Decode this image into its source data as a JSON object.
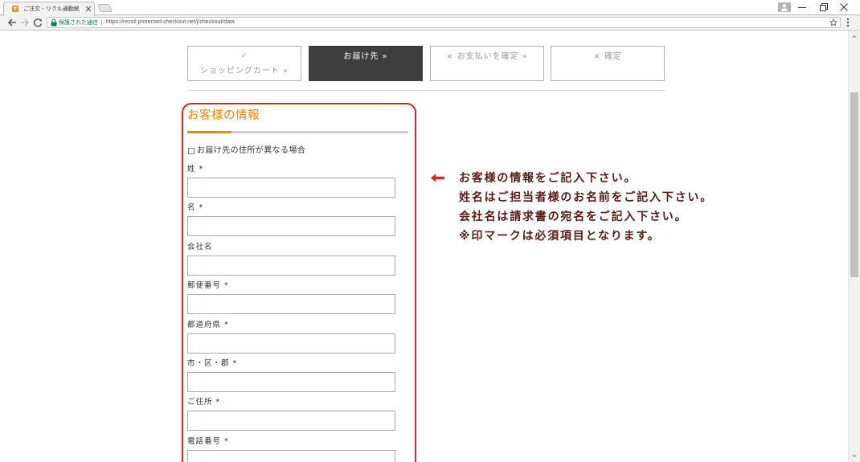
{
  "browser": {
    "tab_title": "ご注文 - リクル通勤統",
    "secure_label": "保護された通信",
    "url": "https://recoil.protected-checkout.net/j/checkout/data"
  },
  "icons": {
    "favicon": "site-favicon-icon",
    "tab_close": "close-icon",
    "profile": "user-profile-icon",
    "minimize": "minimize-icon",
    "restore": "restore-icon",
    "close_window": "close-icon",
    "back": "arrow-left-icon",
    "forward": "arrow-right-icon",
    "reload": "reload-icon",
    "secure": "lock-icon",
    "bookmark": "star-icon",
    "menu": "more-vertical-icon",
    "annotation_arrow": "arrow-left-icon",
    "scroll_up": "triangle-up-icon",
    "scroll_down": "triangle-down-icon"
  },
  "checkout_steps": [
    {
      "mark": "✓",
      "label": "ショッピングカート »",
      "completed": true,
      "active": false
    },
    {
      "label": "お届け先 »",
      "completed": false,
      "active": true
    },
    {
      "label": "× お支払いを確定 »",
      "completed": false,
      "active": false
    },
    {
      "label": "× 確定",
      "completed": false,
      "active": false
    }
  ],
  "form": {
    "title": "お客様の情報",
    "different_address": {
      "label": "お届け先の住所が異なる場合",
      "checked": false
    },
    "fields": [
      {
        "label": "姓",
        "required_mark": "*",
        "value": ""
      },
      {
        "label": "名",
        "required_mark": "*",
        "value": ""
      },
      {
        "label": "会社名",
        "required_mark": "",
        "value": ""
      },
      {
        "label": "郵便番号",
        "required_mark": "*",
        "value": ""
      },
      {
        "label": "都道府県",
        "required_mark": "*",
        "value": ""
      },
      {
        "label": "市・区・郡",
        "required_mark": "*",
        "value": ""
      },
      {
        "label": "ご住所",
        "required_mark": "*",
        "value": ""
      },
      {
        "label": "電話番号",
        "required_mark": "*",
        "value": ""
      }
    ]
  },
  "annotation": {
    "lines": [
      "お客様の情報をご記入下さい。",
      "姓名はご担当者様のお名前をご記入下さい。",
      "会社名は請求書の宛名をご記入下さい。",
      "※印マークは必須項目となります。"
    ]
  },
  "colors": {
    "accent_orange": "#e8870e",
    "highlight_red": "#e3201b",
    "annotation_text": "#5a1a14",
    "active_step": "#3e3e3e",
    "secure_green": "#0b8043"
  }
}
